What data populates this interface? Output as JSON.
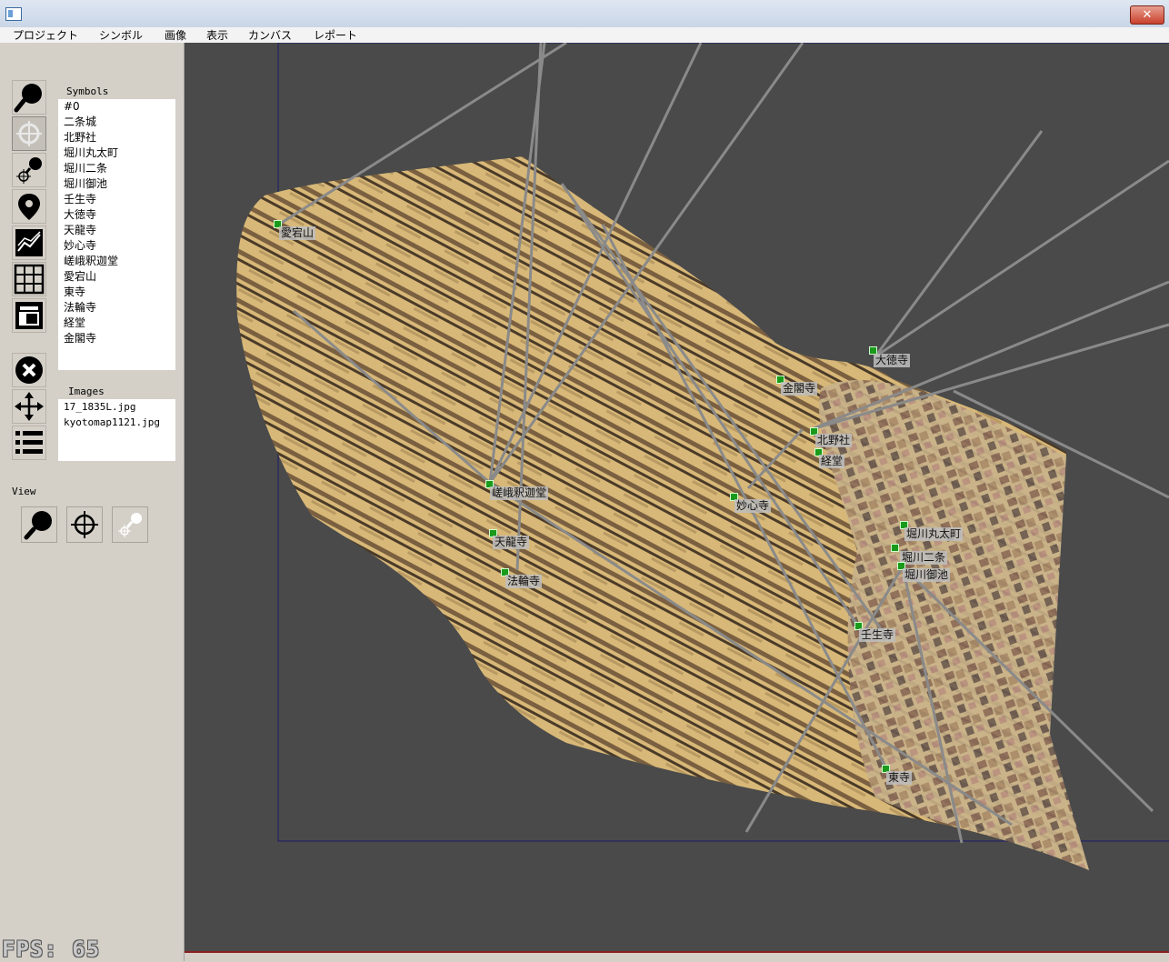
{
  "menu": {
    "items": [
      "プロジェクト",
      "シンボル",
      "画像",
      "表示",
      "カンバス",
      "レポート"
    ]
  },
  "window": {
    "close_glyph": "✕"
  },
  "sidebar": {
    "symbols_label": "Symbols",
    "symbols": [
      "#0",
      "二条城",
      "北野社",
      "堀川丸太町",
      "堀川二条",
      "堀川御池",
      "壬生寺",
      "大徳寺",
      "天龍寺",
      "妙心寺",
      "嵯峨釈迦堂",
      "愛宕山",
      "東寺",
      "法輪寺",
      "経堂",
      "金閣寺"
    ],
    "images_label": "Images",
    "images": [
      "17_1835L.jpg",
      "kyotomap1121.jpg"
    ],
    "view_label": "View",
    "tools": [
      "zoom-tool-icon",
      "target-tool-icon",
      "zoom-target-tool-icon",
      "pin-tool-icon",
      "chart-tool-icon",
      "grid-tool-icon",
      "layout-tool-icon",
      "delete-tool-icon",
      "move-tool-icon",
      "list-tool-icon"
    ]
  },
  "status": {
    "fps": "FPS: 65"
  },
  "canvas": {
    "markers": [
      {
        "label": "愛宕山"
      },
      {
        "label": "金閣寺"
      },
      {
        "label": "大徳寺"
      },
      {
        "label": "北野社"
      },
      {
        "label": "経堂"
      },
      {
        "label": "嵯峨釈迦堂"
      },
      {
        "label": "妙心寺"
      },
      {
        "label": "天龍寺"
      },
      {
        "label": "法輪寺"
      },
      {
        "label": "堀川丸太町"
      },
      {
        "label": "堀川二条"
      },
      {
        "label": "堀川御池"
      },
      {
        "label": "壬生寺"
      },
      {
        "label": "東寺"
      }
    ],
    "colors": {
      "background": "#4a4a4a",
      "map_tan": "#d8b878",
      "map_dark": "#4a3a28",
      "lines": "#8a8a8a",
      "marker": "#1a9a1a"
    }
  }
}
